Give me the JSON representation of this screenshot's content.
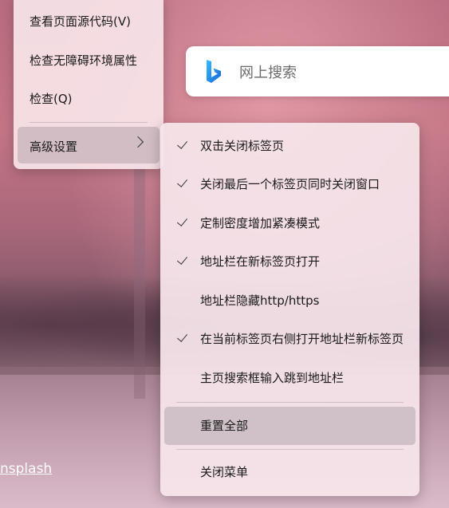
{
  "background": {
    "credit_link": "nsplash"
  },
  "context_menu": {
    "items": [
      {
        "label": "查看页面源代码(V)"
      },
      {
        "label": "检查无障碍环境属性"
      },
      {
        "label": "检查(Q)"
      }
    ],
    "advanced": {
      "label": "高级设置",
      "icon": "chevron-right-icon"
    }
  },
  "search": {
    "logo": "bing-logo",
    "placeholder": "网上搜索"
  },
  "submenu": {
    "items": [
      {
        "label": "双击关闭标签页",
        "checked": true
      },
      {
        "label": "关闭最后一个标签页同时关闭窗口",
        "checked": true
      },
      {
        "label": "定制密度增加紧凑模式",
        "checked": true
      },
      {
        "label": "地址栏在新标签页打开",
        "checked": true
      },
      {
        "label": "地址栏隐藏http/https",
        "checked": false
      },
      {
        "label": "在当前标签页右侧打开地址栏新标签页",
        "checked": true
      },
      {
        "label": "主页搜索框输入跳到地址栏",
        "checked": false
      }
    ],
    "reset_all": "重置全部",
    "close_menu": "关闭菜单"
  },
  "colors": {
    "bing_blue": "#1e8fe0",
    "menu_bg": "#f5e4ea",
    "highlight_bg": "#cdbec6"
  }
}
